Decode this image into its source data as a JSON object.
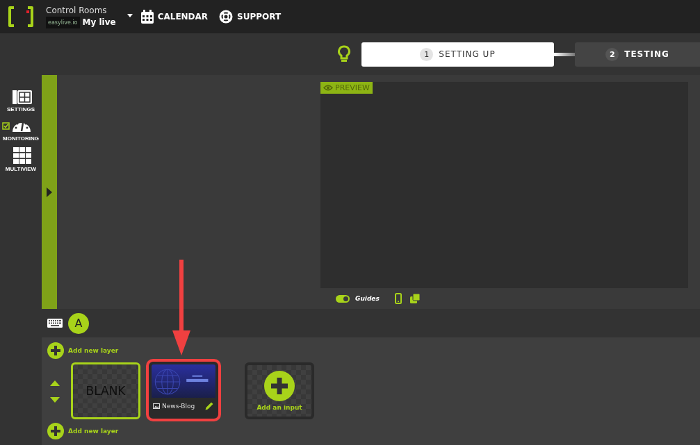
{
  "header": {
    "app_title": "Control Rooms",
    "account_logo": "easylive.io",
    "account": "My live",
    "nav": [
      {
        "kind": "calendar",
        "label": "CALENDAR"
      },
      {
        "kind": "support",
        "label": "SUPPORT"
      }
    ]
  },
  "steps": [
    {
      "number": "1",
      "label": "SETTING UP",
      "selected": true
    },
    {
      "number": "2",
      "label": "TESTING",
      "selected": false
    }
  ],
  "sidebar": [
    {
      "kind": "settings",
      "label": "SETTINGS",
      "checked": false
    },
    {
      "kind": "monitoring",
      "label": "MONITORING",
      "checked": true
    },
    {
      "kind": "multiview",
      "label": "MULTIVIEW",
      "checked": false
    }
  ],
  "preview": {
    "badge": "PREVIEW",
    "guides": {
      "label": "Guides",
      "on": true
    }
  },
  "scene": {
    "label": "A"
  },
  "layers": {
    "add_top": "Add new layer",
    "add_bottom": "Add new layer",
    "items": [
      {
        "kind": "blank",
        "label": "BLANK",
        "selected": true,
        "highlighted": false
      },
      {
        "kind": "input",
        "label": "News-Blog",
        "selected": false,
        "highlighted": true
      }
    ],
    "add_input": "Add an input"
  }
}
